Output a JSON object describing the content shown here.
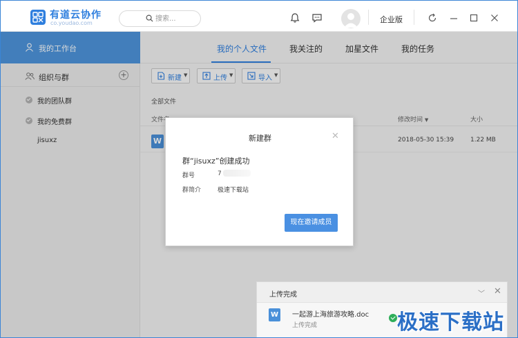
{
  "app": {
    "name": "有道云协作",
    "url": "co.youdao.com",
    "edition": "企业版"
  },
  "search": {
    "placeholder": "搜索..."
  },
  "sidebar": {
    "workspace_label": "我的工作台",
    "group_header": "组织与群",
    "items": [
      {
        "label": "我的团队群"
      },
      {
        "label": "我的免费群"
      },
      {
        "label": "jisuxz"
      }
    ]
  },
  "tabs": [
    {
      "label": "我的个人文件",
      "active": true
    },
    {
      "label": "我关注的"
    },
    {
      "label": "加星文件"
    },
    {
      "label": "我的任务"
    }
  ],
  "toolbar": {
    "new_label": "新建",
    "upload_label": "上传",
    "import_label": "导入"
  },
  "breadcrumb": "全部文件",
  "columns": {
    "name": "文件名",
    "modified": "修改时间",
    "size": "大小"
  },
  "file_row": {
    "modified": "2018-05-30 15:39",
    "size": "1.22 MB"
  },
  "modal": {
    "title": "新建群",
    "message": "群“jisuxz”创建成功",
    "group_id_label": "群号",
    "group_id_value": "7",
    "intro_label": "群简介",
    "intro_value": "极速下载站",
    "invite_button": "现在邀请成员"
  },
  "upload_panel": {
    "title": "上传完成",
    "file_name": "一起游上海旅游攻略.doc",
    "status": "上传完成"
  },
  "watermark": "极速下载站",
  "colors": {
    "accent": "#2f7fde",
    "sidebar_active": "#4e95dc",
    "button": "#4a90e2",
    "success": "#2fae5a"
  }
}
